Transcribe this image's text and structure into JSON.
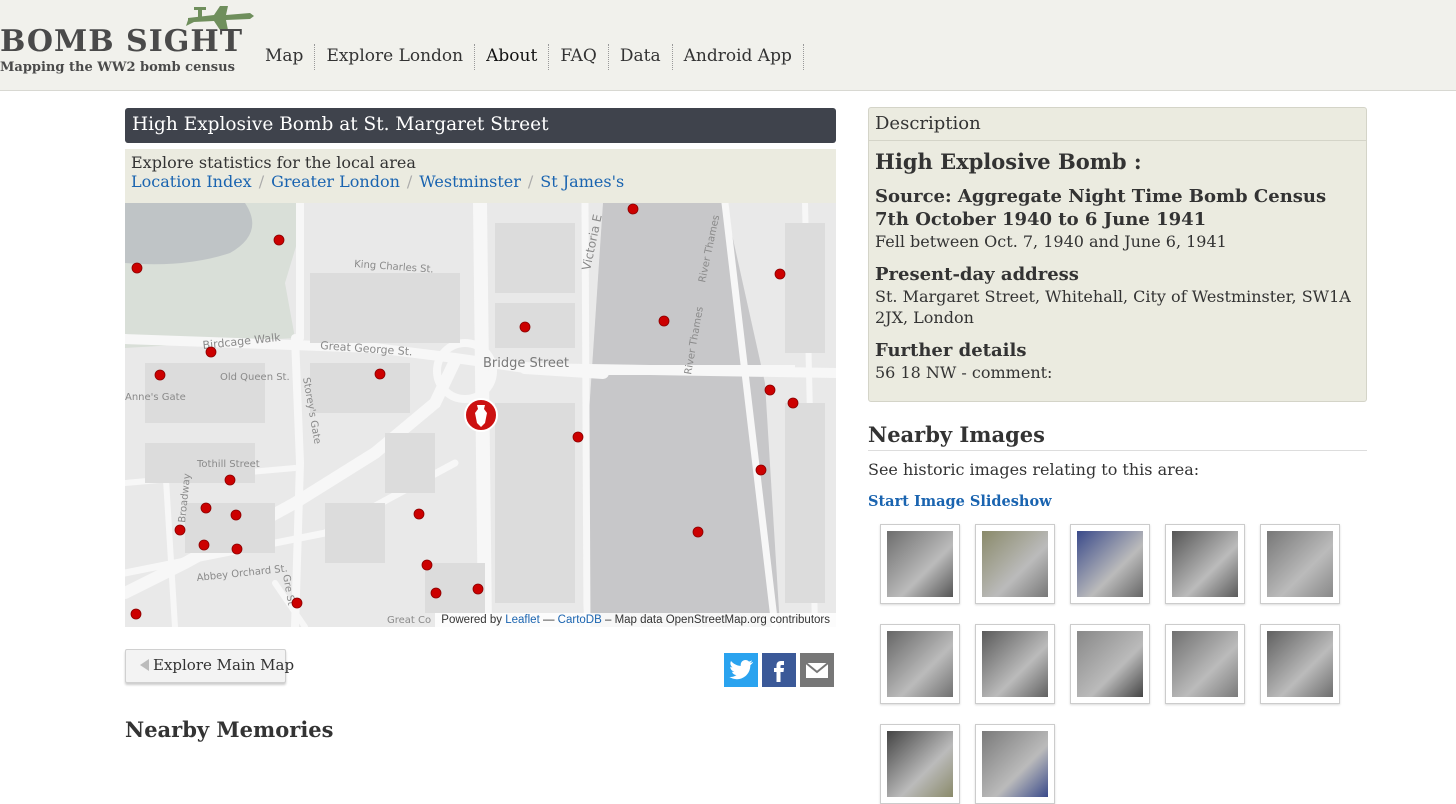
{
  "site": {
    "logo_title": "BOMB SIGHT",
    "logo_subtitle": "Mapping the WW2 bomb census"
  },
  "nav": [
    "Map",
    "Explore London",
    "About",
    "FAQ",
    "Data",
    "Android App"
  ],
  "page": {
    "title": "High Explosive Bomb at St. Margaret Street",
    "area_label": "Explore statistics for the local area",
    "breadcrumbs": [
      "Location Index",
      "Greater London",
      "Westminster",
      "St James's"
    ]
  },
  "map": {
    "street_labels": [
      "King Charles St.",
      "Birdcage Walk",
      "Great George St.",
      "Old Queen St.",
      "Bridge Street",
      "Victoria E",
      "River Thames",
      "River Thames",
      "Anne's Gate",
      "Tothill Street",
      "Abbey Orchard St.",
      "Storey's Gate",
      "Gre St",
      "Broadway",
      "Great Co"
    ],
    "attribution": {
      "powered_by": "Powered by",
      "leaflet": "Leaflet",
      "dash": "—",
      "cartodb": "CartoDB",
      "rest": "– Map data OpenStreetMap.org contributors"
    }
  },
  "actions": {
    "explore_main_map": "Explore Main Map",
    "share_icons": [
      "twitter-icon",
      "facebook-icon",
      "email-icon"
    ]
  },
  "memories": {
    "title": "Nearby Memories"
  },
  "description": {
    "header": "Description",
    "bomb_type": "High Explosive Bomb :",
    "source_heading": "Source: Aggregate Night Time Bomb Census 7th October 1940 to 6 June 1941",
    "source_text": "Fell between Oct. 7, 1940 and June 6, 1941",
    "address_heading": "Present-day address",
    "address_text": "St. Margaret Street, Whitehall, City of Westminster, SW1A 2JX, London",
    "details_heading": "Further details",
    "details_text": "56 18 NW - comment:"
  },
  "nearby_images": {
    "title": "Nearby Images",
    "text": "See historic images relating to this area:",
    "slideshow_link": "Start Image Slideshow",
    "count": 12
  },
  "colors": {
    "title_bar": "#3f434c",
    "link": "#1a64b0",
    "panel": "#ebebe0",
    "marker": "#cc0000",
    "header_bg": "#f1f1ec"
  }
}
